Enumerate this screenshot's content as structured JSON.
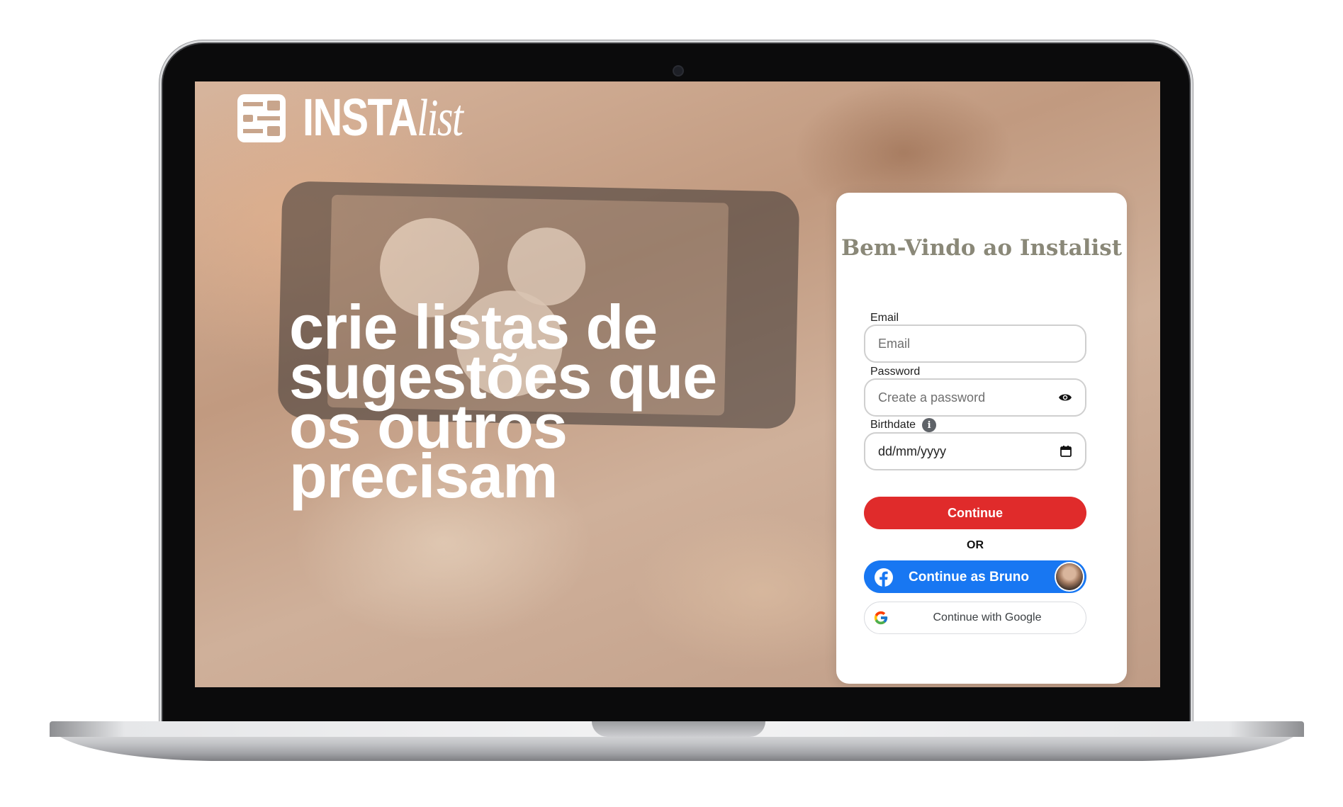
{
  "brand": {
    "logo_main": "INSTA",
    "logo_italic": "list"
  },
  "hero": {
    "tagline": "crie listas de sugestões que os outros precisam"
  },
  "login": {
    "title": "Bem-Vindo ao Instalist",
    "email_label": "Email",
    "email_placeholder": "Email",
    "password_label": "Password",
    "password_placeholder": "Create a password",
    "birthdate_label": "Birthdate",
    "birthdate_placeholder": "dd/mm/yyyy",
    "continue_label": "Continue",
    "or_label": "OR",
    "facebook_label": "Continue as Bruno",
    "google_label": "Continue with Google"
  },
  "icons": {
    "logo": "instalist-logo-icon",
    "password_toggle": "eye-icon",
    "birthdate_info": "info-icon",
    "calendar": "calendar-icon",
    "facebook": "facebook-icon",
    "google": "google-icon"
  },
  "colors": {
    "continue": "#e02b2b",
    "facebook": "#1877f2",
    "title": "#8a8878"
  }
}
